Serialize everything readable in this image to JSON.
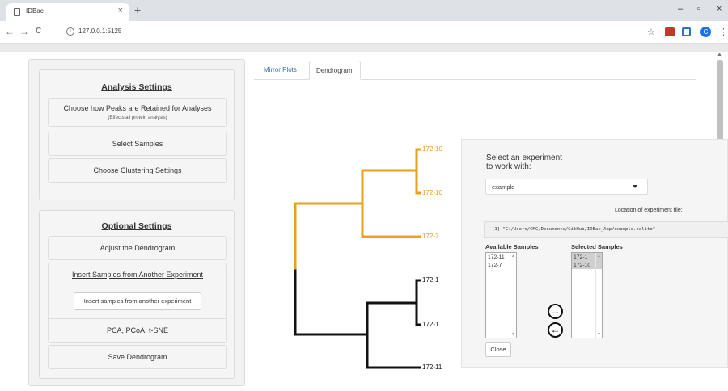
{
  "browser": {
    "tab_title": "IDBac",
    "tab_close": "×",
    "new_tab": "+",
    "back": "←",
    "forward": "→",
    "reload": "C",
    "info": "i",
    "url": "127.0.0.1:5125",
    "minimize": "–",
    "maximize": "▫",
    "close": "×",
    "bookmark": "☆",
    "menu": "⋮",
    "profile": "C"
  },
  "sidebar": {
    "analysis": {
      "heading": "Analysis Settings",
      "peaks_label": "Choose how Peaks are Retained for Analyses",
      "peaks_sub": "(Effects all protein analysis)",
      "select_samples": "Select Samples",
      "clustering": "Choose Clustering Settings"
    },
    "optional": {
      "heading": "Optional Settings",
      "adjust": "Adjust the Dendrogram",
      "insert_heading": "Insert Samples from Another Experiment",
      "insert_button": "Insert samples from another experiment",
      "pca": "PCA, PCoA, t-SNE",
      "save": "Save Dendrogram"
    }
  },
  "main_tabs": [
    "Mirror Plots",
    "Dendrogram"
  ],
  "dendrogram": {
    "leaves": [
      "172-10",
      "172-10",
      "172-7",
      "172-1",
      "172-1",
      "172-11"
    ],
    "colors": {
      "orange": "#e8a020",
      "black": "#111111"
    }
  },
  "modal": {
    "title_line1": "Select an experiment",
    "title_line2": "to work with:",
    "experiment": "example",
    "location_label": "Location of experiment file:",
    "location_value": "[1] \"C:/Users/CMC/Documents/GitHub/IDBac_App/example.sqlite\"",
    "available_label": "Available Samples",
    "selected_label": "Selected Samples",
    "available": [
      "172-11",
      "172-7"
    ],
    "selected": [
      "172-1",
      "172-10"
    ],
    "add_arrow": "→",
    "remove_arrow": "←",
    "close": "Close"
  }
}
